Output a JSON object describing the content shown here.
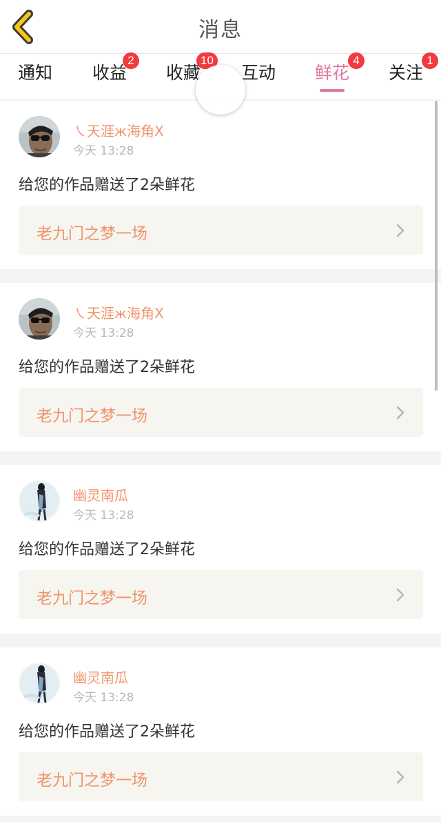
{
  "header": {
    "title": "消息",
    "back_icon": "chevron-left-icon",
    "accent_color": "#f5c518"
  },
  "tabs": [
    {
      "label": "通知",
      "badge": ""
    },
    {
      "label": "收益",
      "badge": "2"
    },
    {
      "label": "收藏",
      "badge": "10"
    },
    {
      "label": "互动",
      "badge": ""
    },
    {
      "label": "鲜花",
      "badge": "4",
      "active": true
    },
    {
      "label": "关注",
      "badge": "1"
    }
  ],
  "colors": {
    "active_tab": "#e0779d",
    "badge": "#f23a3f",
    "username": "#f0946c",
    "link_background": "#f6f5ef"
  },
  "messages": [
    {
      "user": "㇏天涯ж海角Ⅹ",
      "avatar": "sunglasses-man-avatar",
      "time": "今天 13:28",
      "text": "给您的作品赠送了2朵鲜花",
      "work": "老九门之梦一场"
    },
    {
      "user": "㇏天涯ж海角Ⅹ",
      "avatar": "sunglasses-man-avatar",
      "time": "今天 13:28",
      "text": "给您的作品赠送了2朵鲜花",
      "work": "老九门之梦一场"
    },
    {
      "user": "幽灵南瓜",
      "avatar": "figure-avatar",
      "time": "今天 13:28",
      "text": "给您的作品赠送了2朵鲜花",
      "work": "老九门之梦一场"
    },
    {
      "user": "幽灵南瓜",
      "avatar": "figure-avatar",
      "time": "今天 13:28",
      "text": "给您的作品赠送了2朵鲜花",
      "work": "老九门之梦一场"
    }
  ]
}
